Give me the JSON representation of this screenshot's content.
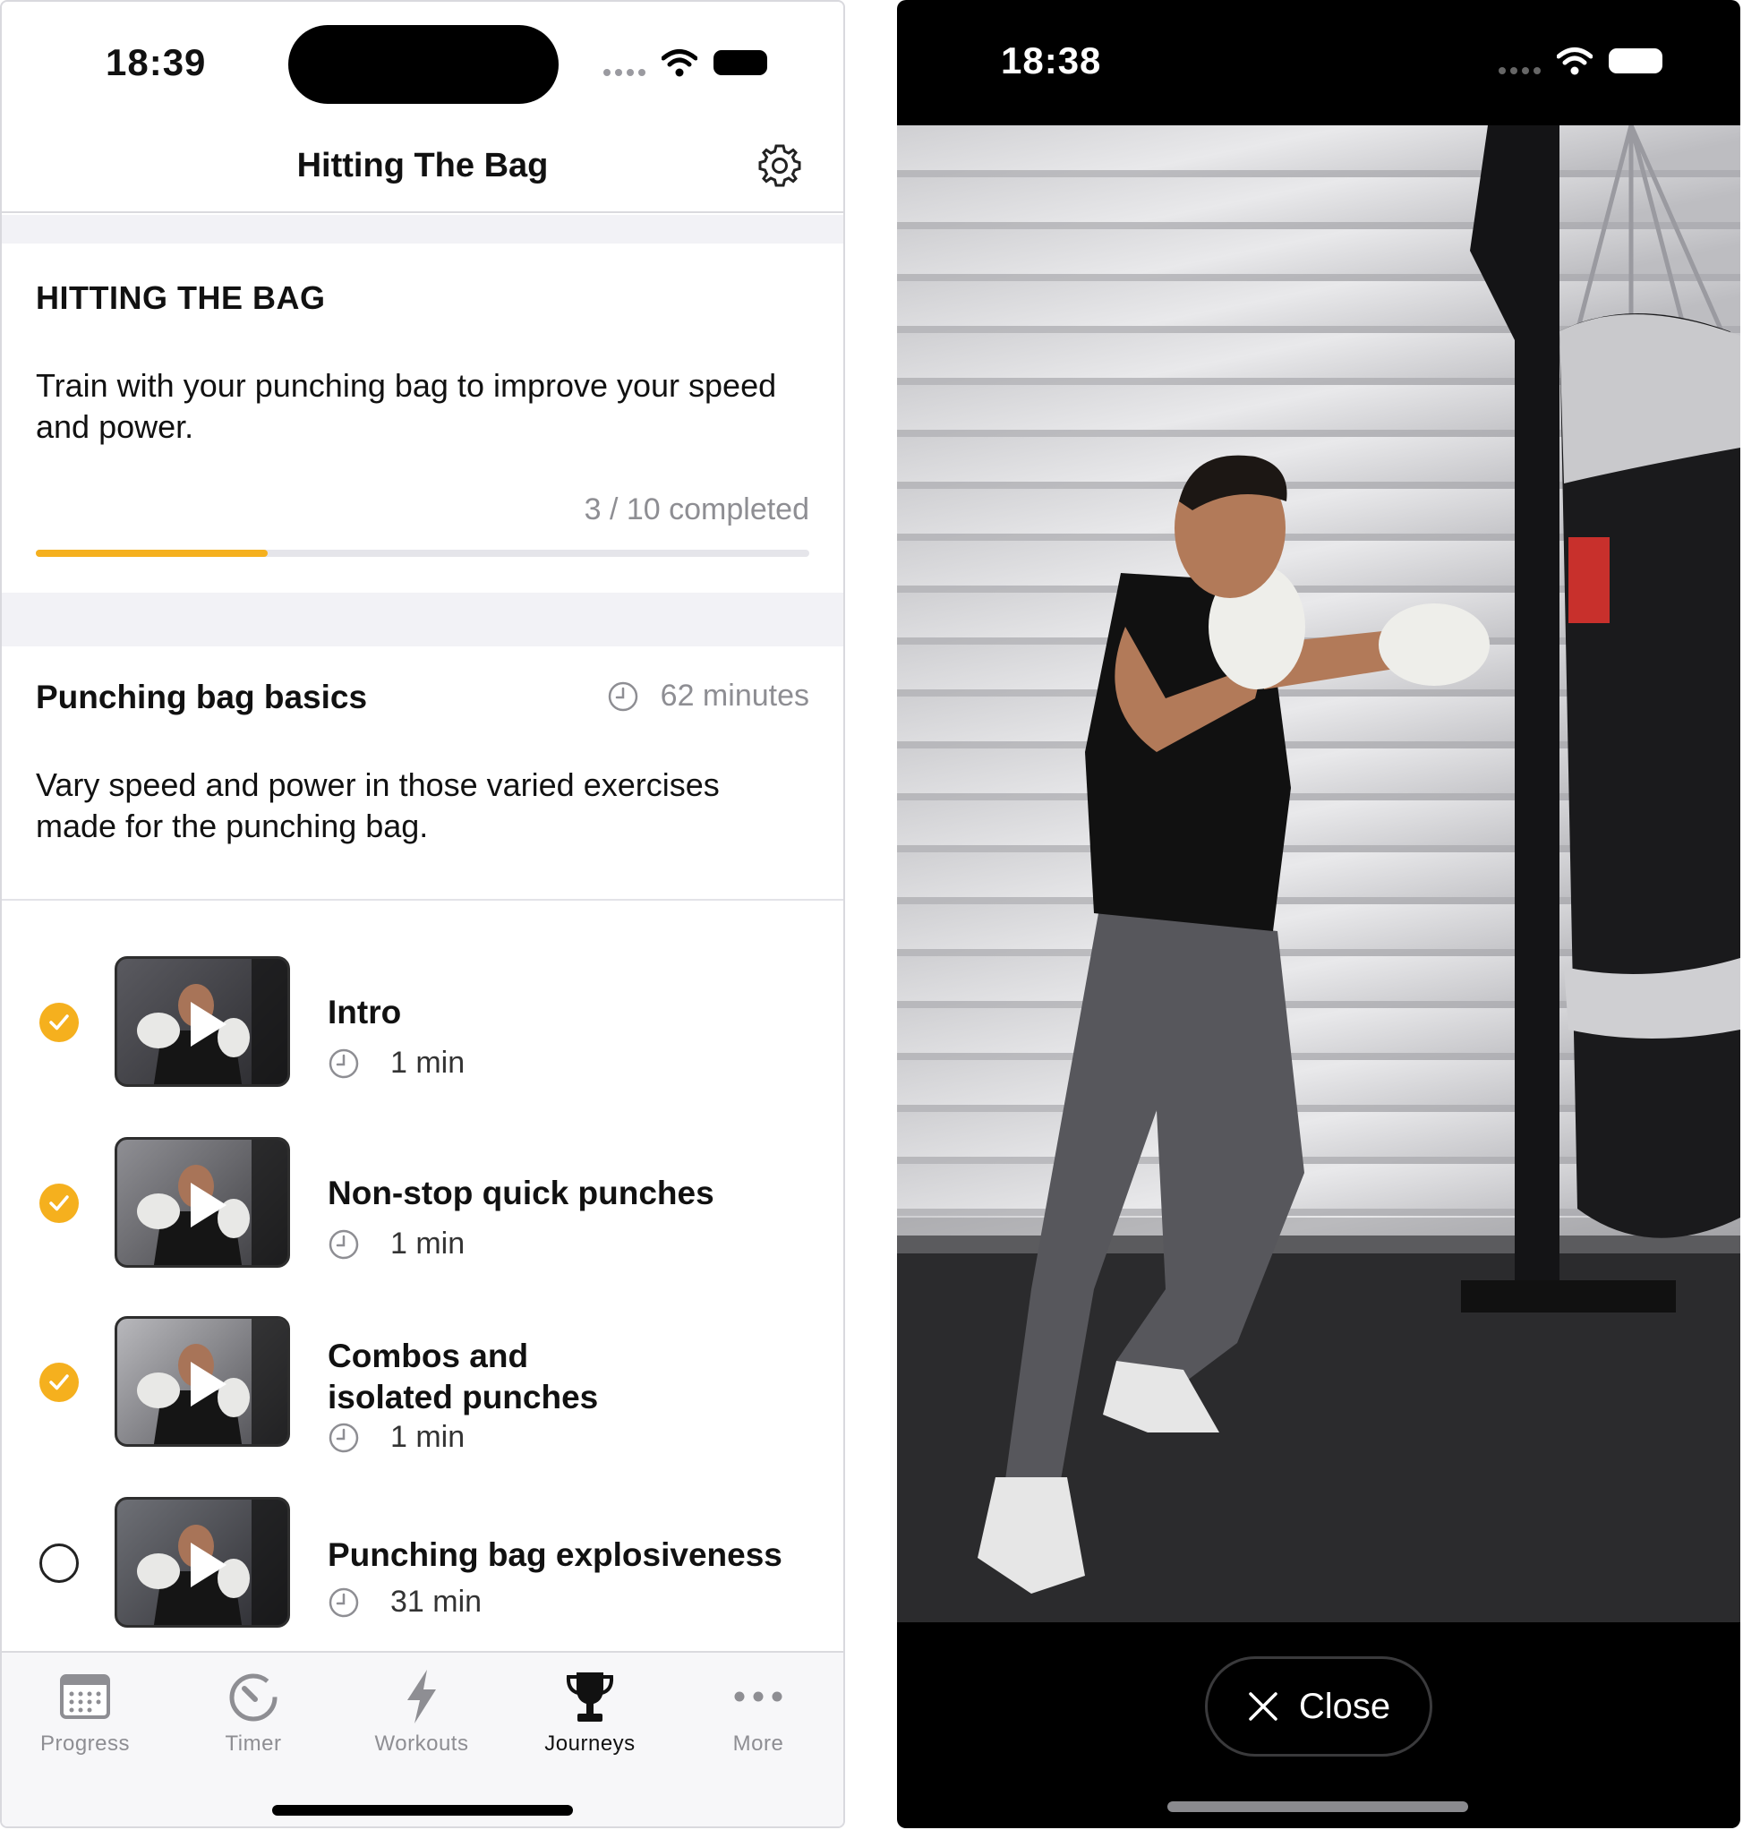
{
  "left_screen": {
    "status_bar": {
      "time": "18:39"
    },
    "nav": {
      "title": "Hitting The Bag",
      "settings_icon": "gear-icon"
    },
    "journey": {
      "heading": "HITTING THE BAG",
      "description": "Train with your punching bag to improve your speed and power.",
      "progress_text": "3 / 10 completed",
      "progress_fraction": 0.3,
      "accent_color": "#f5b01e"
    },
    "section": {
      "title": "Punching bag basics",
      "duration": "62 minutes",
      "description": "Vary speed and power in those varied exercises made for the punching bag."
    },
    "lessons": [
      {
        "title": "Intro",
        "duration": "1 min",
        "completed": true
      },
      {
        "title": "Non-stop quick punches",
        "duration": "1 min",
        "completed": true
      },
      {
        "title": "Combos and isolated punches",
        "duration": "1 min",
        "completed": true
      },
      {
        "title": "Punching bag explosiveness",
        "duration": "31 min",
        "completed": false
      }
    ],
    "tab_bar": {
      "tabs": [
        {
          "label": "Progress",
          "icon": "calendar-icon",
          "active": false
        },
        {
          "label": "Timer",
          "icon": "timer-icon",
          "active": false
        },
        {
          "label": "Workouts",
          "icon": "lightning-icon",
          "active": false
        },
        {
          "label": "Journeys",
          "icon": "trophy-icon",
          "active": true
        },
        {
          "label": "More",
          "icon": "more-dots-icon",
          "active": false
        }
      ]
    }
  },
  "right_screen": {
    "status_bar": {
      "time": "18:38"
    },
    "video": {
      "subject": "boxer-punching-bag-video"
    },
    "close_button": {
      "label": "Close",
      "icon": "close-x-icon"
    }
  }
}
